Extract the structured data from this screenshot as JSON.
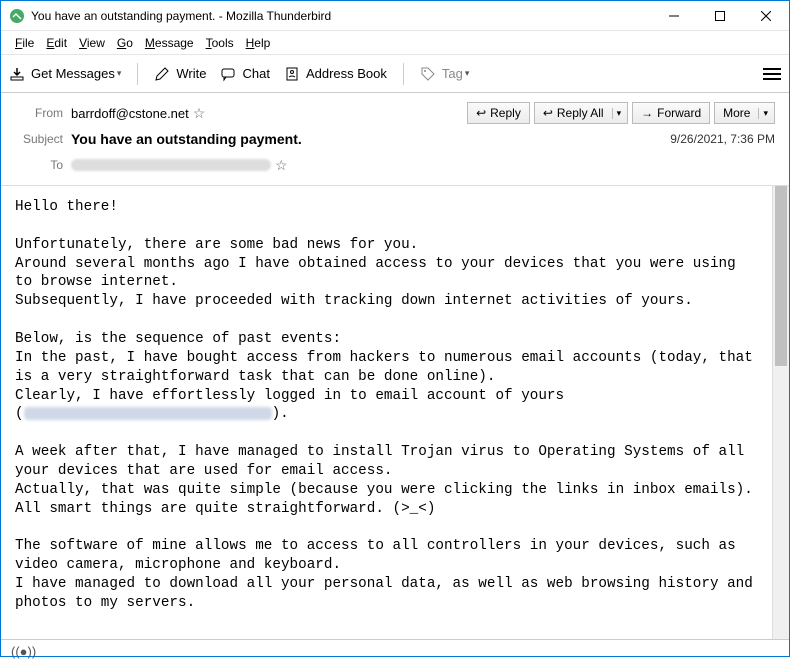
{
  "titlebar": {
    "title": "You have an outstanding payment. - Mozilla Thunderbird"
  },
  "menubar": {
    "file": "File",
    "edit": "Edit",
    "view": "View",
    "go": "Go",
    "message": "Message",
    "tools": "Tools",
    "help": "Help"
  },
  "toolbar": {
    "get_messages": "Get Messages",
    "write": "Write",
    "chat": "Chat",
    "address_book": "Address Book",
    "tag": "Tag"
  },
  "header": {
    "from_label": "From",
    "from_value": "barrdoff@cstone.net",
    "subject_label": "Subject",
    "subject_value": "You have an outstanding payment.",
    "to_label": "To",
    "date": "9/26/2021, 7:36 PM",
    "reply": "Reply",
    "reply_all": "Reply All",
    "forward": "Forward",
    "more": "More"
  },
  "body": {
    "p1": "Hello there!",
    "p2": "Unfortunately, there are some bad news for you.\nAround several months ago I have obtained access to your devices that you were using to browse internet.\nSubsequently, I have proceeded with tracking down internet activities of yours.",
    "p3": "Below, is the sequence of past events:\nIn the past, I have bought access from hackers to numerous email accounts (today, that is a very straightforward task that can be done online).\nClearly, I have effortlessly logged in to email account of yours\n(",
    "p3_end": ").",
    "p4": "A week after that, I have managed to install Trojan virus to Operating Systems of all your devices that are used for email access.\nActually, that was quite simple (because you were clicking the links in inbox emails).\nAll smart things are quite straightforward. (>_<)",
    "p5": "The software of mine allows me to access to all controllers in your devices, such as video camera, microphone and keyboard.\nI have managed to download all your personal data, as well as web browsing history and photos to my servers."
  }
}
